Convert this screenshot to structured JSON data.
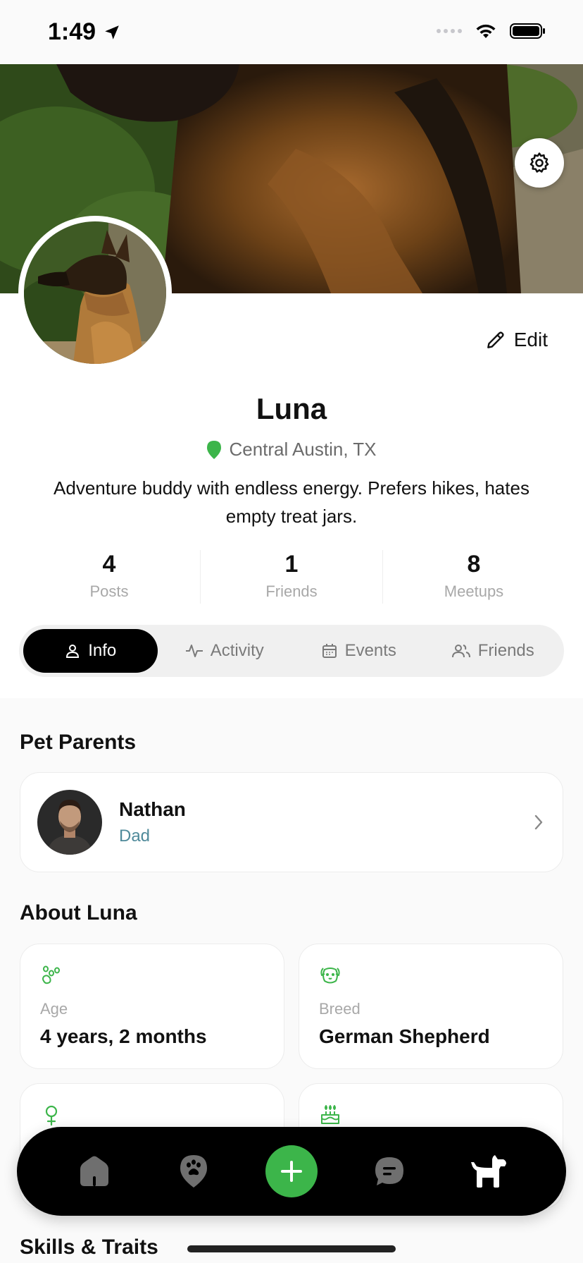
{
  "status_bar": {
    "time": "1:49"
  },
  "profile": {
    "edit_label": "Edit",
    "name": "Luna",
    "location": "Central Austin, TX",
    "bio": "Adventure buddy with endless energy. Prefers hikes, hates empty treat jars."
  },
  "stats": [
    {
      "value": "4",
      "label": "Posts"
    },
    {
      "value": "1",
      "label": "Friends"
    },
    {
      "value": "8",
      "label": "Meetups"
    }
  ],
  "tabs": [
    {
      "label": "Info",
      "icon": "person-icon",
      "active": true
    },
    {
      "label": "Activity",
      "icon": "activity-icon",
      "active": false
    },
    {
      "label": "Events",
      "icon": "calendar-icon",
      "active": false
    },
    {
      "label": "Friends",
      "icon": "people-icon",
      "active": false
    }
  ],
  "pet_parents": {
    "title": "Pet Parents",
    "items": [
      {
        "name": "Nathan",
        "role": "Dad"
      }
    ]
  },
  "about": {
    "title": "About Luna",
    "cards": [
      {
        "icon": "paw-icon",
        "label": "Age",
        "value": "4 years, 2 months"
      },
      {
        "icon": "dog-face-icon",
        "label": "Breed",
        "value": "German Shepherd"
      },
      {
        "icon": "female-icon",
        "label": "",
        "value": ""
      },
      {
        "icon": "cake-icon",
        "label": "",
        "value": ""
      }
    ]
  },
  "skills": {
    "title": "Skills & Traits"
  },
  "bottom_nav": [
    "home-icon",
    "pet-location-icon",
    "add-icon",
    "chat-icon",
    "dog-icon"
  ],
  "colors": {
    "accent_green": "#3cb54a",
    "role_teal": "#4f8a9a",
    "nav_bg": "#000000"
  }
}
